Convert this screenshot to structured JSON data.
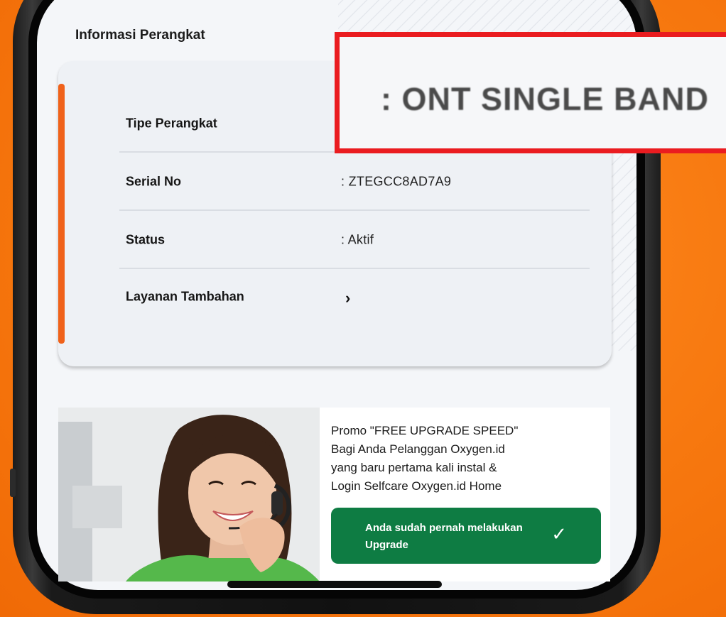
{
  "device_info": {
    "title": "Informasi Perangkat",
    "rows": [
      {
        "label": "Tipe Perangkat",
        "value": ""
      },
      {
        "label": "Serial No",
        "value": ": ZTEGCC8AD7A9"
      },
      {
        "label": "Status",
        "value": ": Aktif"
      },
      {
        "label": "Layanan Tambahan",
        "value": ""
      }
    ],
    "chevron_icon": "chevron-right-icon"
  },
  "zoom_callout": {
    "text": ": ONT SINGLE BAND",
    "border_color": "#ea1c20"
  },
  "promo": {
    "lines": [
      "Promo \"FREE UPGRADE SPEED\"",
      "Bagi Anda Pelanggan Oxygen.id",
      "yang baru pertama kali instal &",
      "Login Selfcare Oxygen.id Home"
    ],
    "button_label": "Anda sudah pernah melakukan Upgrade",
    "button_icon": "checkmark-icon",
    "button_color": "#0e7c43"
  },
  "colors": {
    "background": "#f7780f",
    "accent_bar": "#f0621a"
  }
}
